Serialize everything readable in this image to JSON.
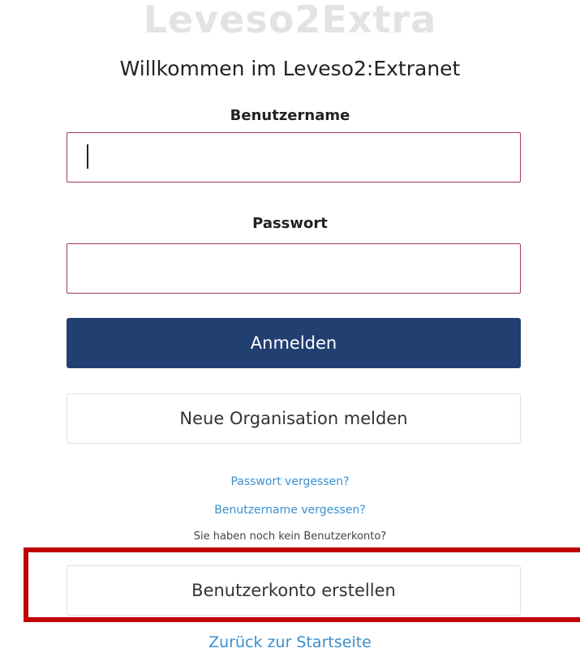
{
  "brand": {
    "title": "Leveso2Extra"
  },
  "login": {
    "welcome": "Willkommen im Leveso2:Extranet",
    "username_label": "Benutzername",
    "username_value": "",
    "password_label": "Passwort",
    "password_value": "",
    "submit_label": "Anmelden",
    "new_org_label": "Neue Organisation melden"
  },
  "links": {
    "forgot_password": "Passwort vergessen?",
    "forgot_username": "Benutzername vergessen?",
    "no_account_note": "Sie haben noch kein Benutzerkonto?",
    "create_account_label": "Benutzerkonto erstellen",
    "back_home": "Zurück zur Startseite"
  },
  "colors": {
    "primary_button": "#223f72",
    "input_border": "#a23a4e",
    "link": "#3a8fd0",
    "highlight": "#c00000"
  }
}
